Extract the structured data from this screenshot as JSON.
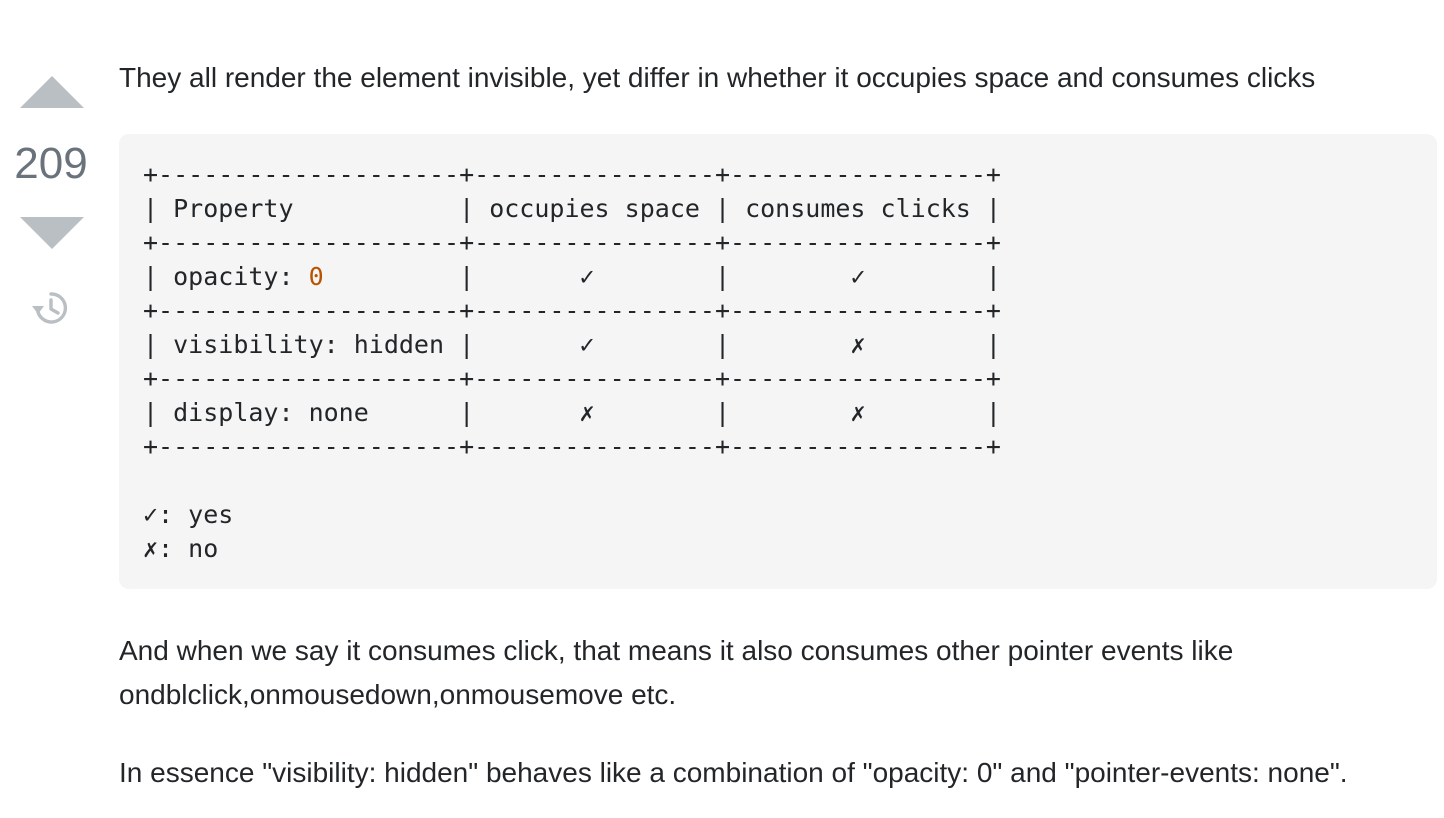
{
  "vote": {
    "score": "209",
    "upvote_icon": "triangle-up-icon",
    "downvote_icon": "triangle-down-icon",
    "history_icon": "history-icon"
  },
  "answer": {
    "intro": "They all render the element invisible, yet differ in whether it occupies space and consumes clicks",
    "code": {
      "border": "+--------------------+----------------+-----------------+",
      "header": {
        "property": "Property",
        "occupies_space": "occupies space",
        "consumes_clicks": "consumes clicks"
      },
      "rows": [
        {
          "key": "opacity: ",
          "value": "0",
          "occupies_space": "✓",
          "consumes_clicks": "✓"
        },
        {
          "key": "visibility: hidden",
          "value": "",
          "occupies_space": "✓",
          "consumes_clicks": "✗"
        },
        {
          "key": "display: none",
          "value": "",
          "occupies_space": "✗",
          "consumes_clicks": "✗"
        }
      ],
      "legend": [
        "✓: yes",
        "✗: no"
      ]
    },
    "paragraph_2": "And when we say it consumes click, that means it also consumes other pointer events like ondblclick,onmousedown,onmousemove etc.",
    "paragraph_3": "In essence \"visibility: hidden\" behaves like a combination of \"opacity: 0\" and \"pointer-events: none\"."
  },
  "colors": {
    "text": "#232629",
    "vote_arrow": "#babfc4",
    "vote_count": "#6a737c",
    "code_background": "#f5f5f5",
    "code_number": "#b75301"
  }
}
